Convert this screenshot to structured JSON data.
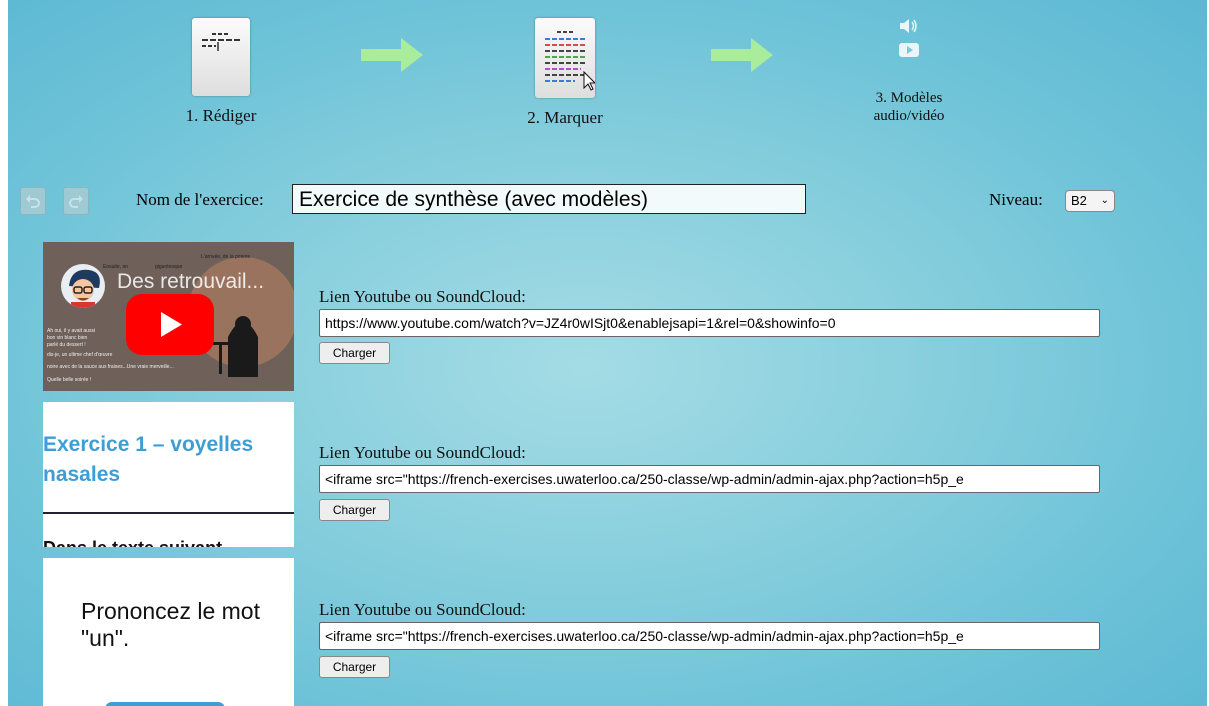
{
  "steps": [
    {
      "label": "1. Rédiger",
      "icon": "document-icon"
    },
    {
      "label": "2. Marquer",
      "icon": "marked-document-icon"
    },
    {
      "label": "3. Modèles audio/vidéo",
      "icons": [
        "speaker-icon",
        "play-icon"
      ]
    }
  ],
  "toolbar": {
    "undo_icon": "undo-icon",
    "redo_icon": "redo-icon",
    "name_label": "Nom de l'exercice:",
    "name_value": "Exercice de synthèse (avec modèles)",
    "niveau_label": "Niveau:",
    "niveau_value": "B2"
  },
  "models": [
    {
      "thumbnail": {
        "type": "youtube",
        "title": "Des retrouvail...",
        "words": [
          "L'arrivée, de la poterie",
          "Ensuite, on",
          "gigantesque",
          "Ah oui, il y avait aussi",
          "bon vin blanc bien",
          "parlé du dessert !",
          "dis-je, un ultime chef d'œuvre",
          "noire avec de la sauce aux fraises...Une vraie merveille...",
          "Quelle belle soirée !"
        ]
      },
      "link_label": "Lien Youtube ou SoundCloud:",
      "link_value": "https://www.youtube.com/watch?v=JZ4r0wISjt0&enablejsapi=1&rel=0&showinfo=0",
      "button": "Charger"
    },
    {
      "thumbnail": {
        "type": "h5p",
        "title": "Exercice 1 – voyelles nasales",
        "footer": "Dans le texte suivant"
      },
      "link_label": "Lien Youtube ou SoundCloud:",
      "link_value": "<iframe src=\"https://french-exercises.uwaterloo.ca/250-classe/wp-admin/admin-ajax.php?action=h5p_e",
      "button": "Charger"
    },
    {
      "thumbnail": {
        "type": "h5p",
        "title": "Prononcez le mot \"un\"."
      },
      "link_label": "Lien Youtube ou SoundCloud:",
      "link_value": "<iframe src=\"https://french-exercises.uwaterloo.ca/250-classe/wp-admin/admin-ajax.php?action=h5p_e",
      "button": "Charger"
    }
  ],
  "colors": {
    "arrow": "#a9ec9c",
    "background": "#8bd0de",
    "youtube_red": "#ff0000",
    "h5p_title": "#3d9ed6"
  }
}
